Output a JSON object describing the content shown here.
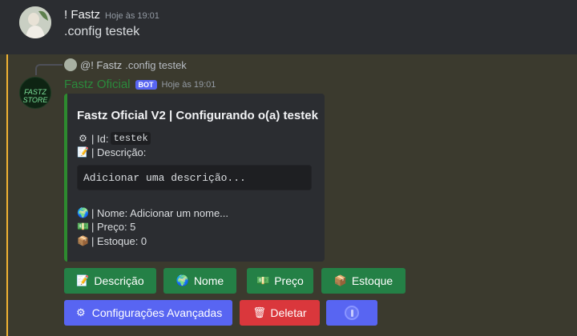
{
  "message1": {
    "author": "! Fastz",
    "timestamp": "Hoje às 19:01",
    "content": ".config testek"
  },
  "message2": {
    "reply_author": "@! Fastz",
    "reply_content": ".config testek",
    "author": "Fastz Oficial",
    "bot_badge": "BOT",
    "timestamp": "Hoje às 19:01",
    "avatar_text": "FASTZ STORE",
    "embed": {
      "title": "Fastz Oficial V2 | Configurando o(a) testek",
      "id_label": "| Id:",
      "id_value": "testek",
      "desc_label": "| Descrição:",
      "desc_code": "Adicionar uma descrição...",
      "name_line": "| Nome: Adicionar um nome...",
      "price_line": "| Preço: 5",
      "stock_line": "| Estoque: 0",
      "accent_color": "#2d8a2f"
    }
  },
  "buttons": {
    "descricao": "Descrição",
    "nome": "Nome",
    "preco": "Preço",
    "estoque": "Estoque",
    "avancadas": "Configurações Avançadas",
    "deletar": "Deletar"
  },
  "colors": {
    "success": "#248046",
    "primary": "#5865f2",
    "danger": "#da373c",
    "mention_highlight": "#f0b232"
  }
}
